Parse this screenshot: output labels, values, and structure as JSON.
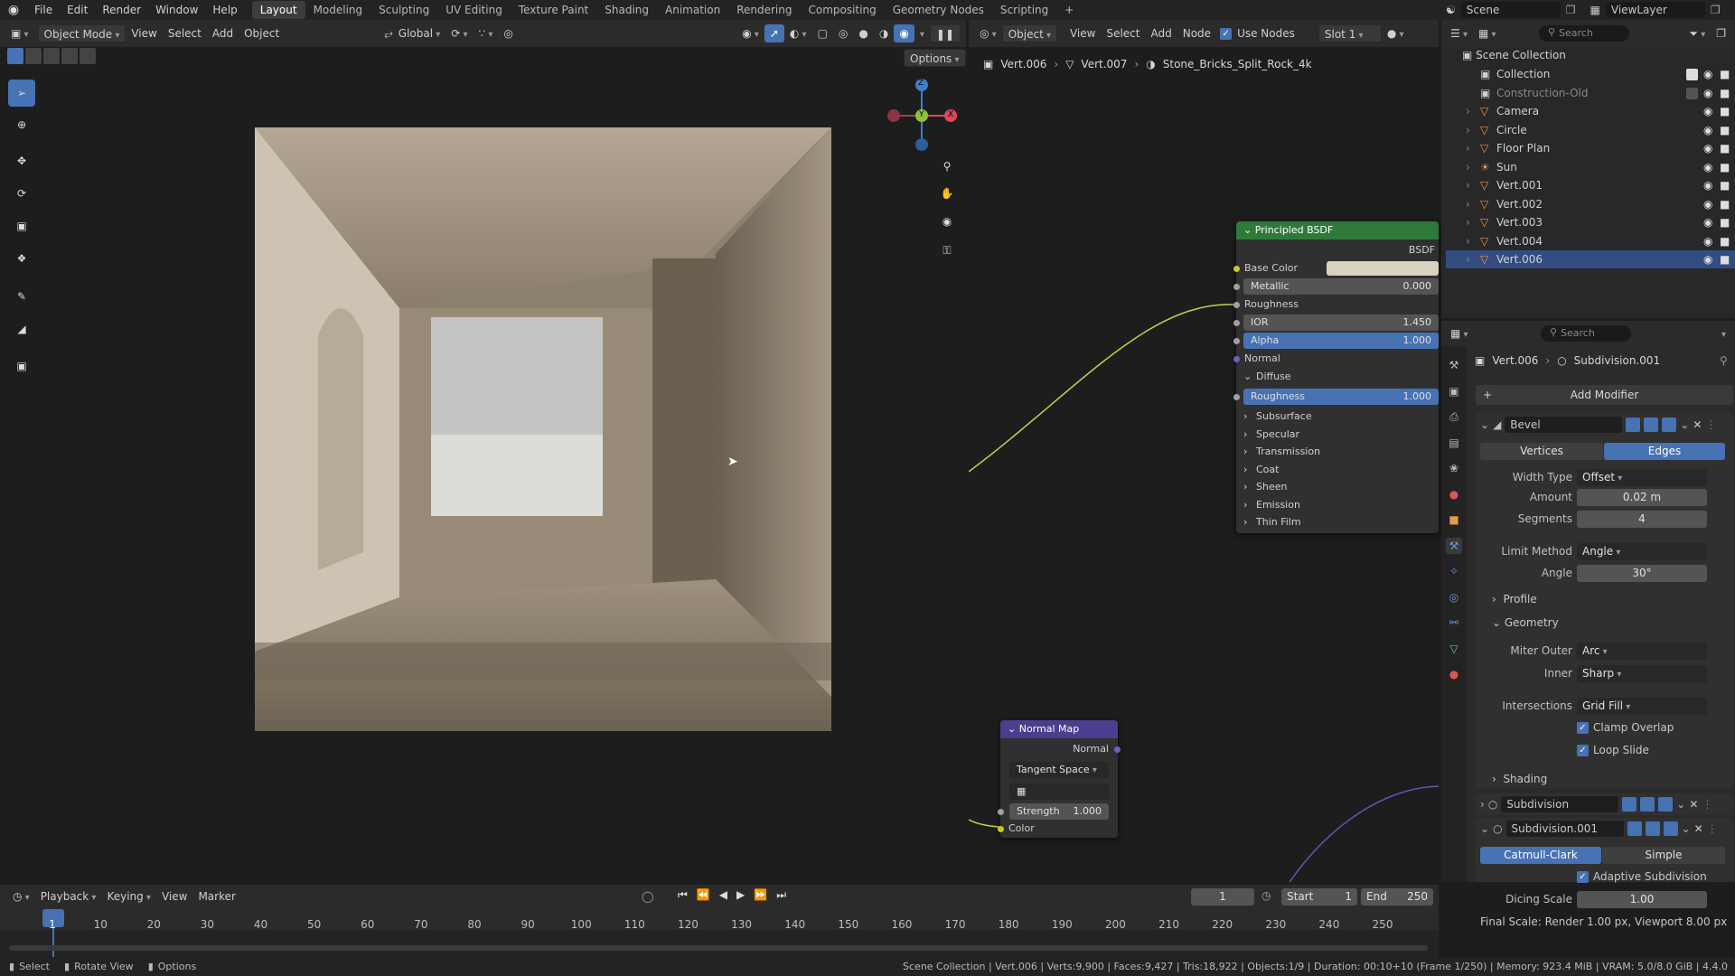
{
  "topbar": {
    "menus": [
      "File",
      "Edit",
      "Render",
      "Window",
      "Help"
    ],
    "workspaces": [
      "Layout",
      "Modeling",
      "Sculpting",
      "UV Editing",
      "Texture Paint",
      "Shading",
      "Animation",
      "Rendering",
      "Compositing",
      "Geometry Nodes",
      "Scripting"
    ],
    "active_workspace": "Layout",
    "scene_label": "Scene",
    "viewlayer_label": "ViewLayer"
  },
  "viewport": {
    "mode": "Object Mode",
    "menus": [
      "View",
      "Select",
      "Add",
      "Object"
    ],
    "transform_orientation": "Global",
    "options_label": "Options",
    "gizmo": {
      "x": "X",
      "y": "Y",
      "z": "Z"
    }
  },
  "node_editor": {
    "object_mode": "Object",
    "menus": [
      "View",
      "Select",
      "Add",
      "Node"
    ],
    "use_nodes_label": "Use Nodes",
    "slot": "Slot 1",
    "breadcrumb": [
      "Vert.006",
      "Vert.007",
      "Stone_Bricks_Split_Rock_4k"
    ],
    "principled": {
      "title": "Principled BSDF",
      "output": "BSDF",
      "base_color_label": "Base Color",
      "metallic_label": "Metallic",
      "metallic_value": "0.000",
      "roughness_label": "Roughness",
      "ior_label": "IOR",
      "ior_value": "1.450",
      "alpha_label": "Alpha",
      "alpha_value": "1.000",
      "normal_label": "Normal",
      "diffuse_label": "Diffuse",
      "diffuse_roughness_label": "Roughness",
      "diffuse_roughness_value": "1.000",
      "panels": [
        "Subsurface",
        "Specular",
        "Transmission",
        "Coat",
        "Sheen",
        "Emission",
        "Thin Film"
      ]
    },
    "normal_map": {
      "title": "Normal Map",
      "output": "Normal",
      "space": "Tangent Space",
      "strength_label": "Strength",
      "strength_value": "1.000",
      "color_label": "Color"
    }
  },
  "outliner": {
    "search_placeholder": "Search",
    "root": "Scene Collection",
    "items": [
      {
        "name": "Collection",
        "type": "collection"
      },
      {
        "name": "Construction-Old",
        "type": "collection"
      },
      {
        "name": "Camera",
        "type": "camera"
      },
      {
        "name": "Circle",
        "type": "mesh"
      },
      {
        "name": "Floor Plan",
        "type": "mesh"
      },
      {
        "name": "Sun",
        "type": "light"
      },
      {
        "name": "Vert.001",
        "type": "mesh"
      },
      {
        "name": "Vert.002",
        "type": "mesh"
      },
      {
        "name": "Vert.003",
        "type": "mesh"
      },
      {
        "name": "Vert.004",
        "type": "mesh"
      },
      {
        "name": "Vert.006",
        "type": "mesh"
      }
    ],
    "selected": "Vert.006"
  },
  "properties": {
    "search_placeholder": "Search",
    "breadcrumb_object": "Vert.006",
    "breadcrumb_modifier": "Subdivision.001",
    "add_modifier_label": "Add Modifier",
    "bevel": {
      "name": "Bevel",
      "tab_vertices": "Vertices",
      "tab_edges": "Edges",
      "width_type_label": "Width Type",
      "width_type_value": "Offset",
      "amount_label": "Amount",
      "amount_value": "0.02 m",
      "segments_label": "Segments",
      "segments_value": "4",
      "limit_method_label": "Limit Method",
      "limit_method_value": "Angle",
      "angle_label": "Angle",
      "angle_value": "30°",
      "profile_label": "Profile",
      "geometry_label": "Geometry",
      "miter_outer_label": "Miter Outer",
      "miter_outer_value": "Arc",
      "inner_label": "Inner",
      "inner_value": "Sharp",
      "intersections_label": "Intersections",
      "intersections_value": "Grid Fill",
      "clamp_overlap_label": "Clamp Overlap",
      "loop_slide_label": "Loop Slide",
      "shading_label": "Shading"
    },
    "subdivision": {
      "name": "Subdivision"
    },
    "subdivision001": {
      "name": "Subdivision.001",
      "tab_catmull": "Catmull-Clark",
      "tab_simple": "Simple",
      "adaptive_label": "Adaptive Subdivision",
      "dicing_label": "Dicing Scale",
      "dicing_value": "1.00",
      "final_scale": "Final Scale: Render 1.00 px, Viewport 8.00 px"
    }
  },
  "timeline": {
    "menus": [
      "Playback",
      "Keying",
      "View",
      "Marker"
    ],
    "current_frame": "1",
    "start_label": "Start",
    "start_value": "1",
    "end_label": "End",
    "end_value": "250",
    "ticks": [
      "1",
      "10",
      "20",
      "30",
      "40",
      "50",
      "60",
      "70",
      "80",
      "90",
      "100",
      "110",
      "120",
      "130",
      "140",
      "150",
      "160",
      "170",
      "180",
      "190",
      "200",
      "210",
      "220",
      "230",
      "240",
      "250"
    ]
  },
  "statusbar": {
    "left": [
      "Select",
      "Rotate View",
      "Options"
    ],
    "right": "Scene Collection | Vert.006 | Verts:9,900 | Faces:9,427 | Tris:18,922 | Objects:1/9 | Duration: 00:10+10 (Frame 1/250) | Memory: 923.4 MiB | VRAM: 5.0/8.0 GiB | 4.4.0"
  }
}
